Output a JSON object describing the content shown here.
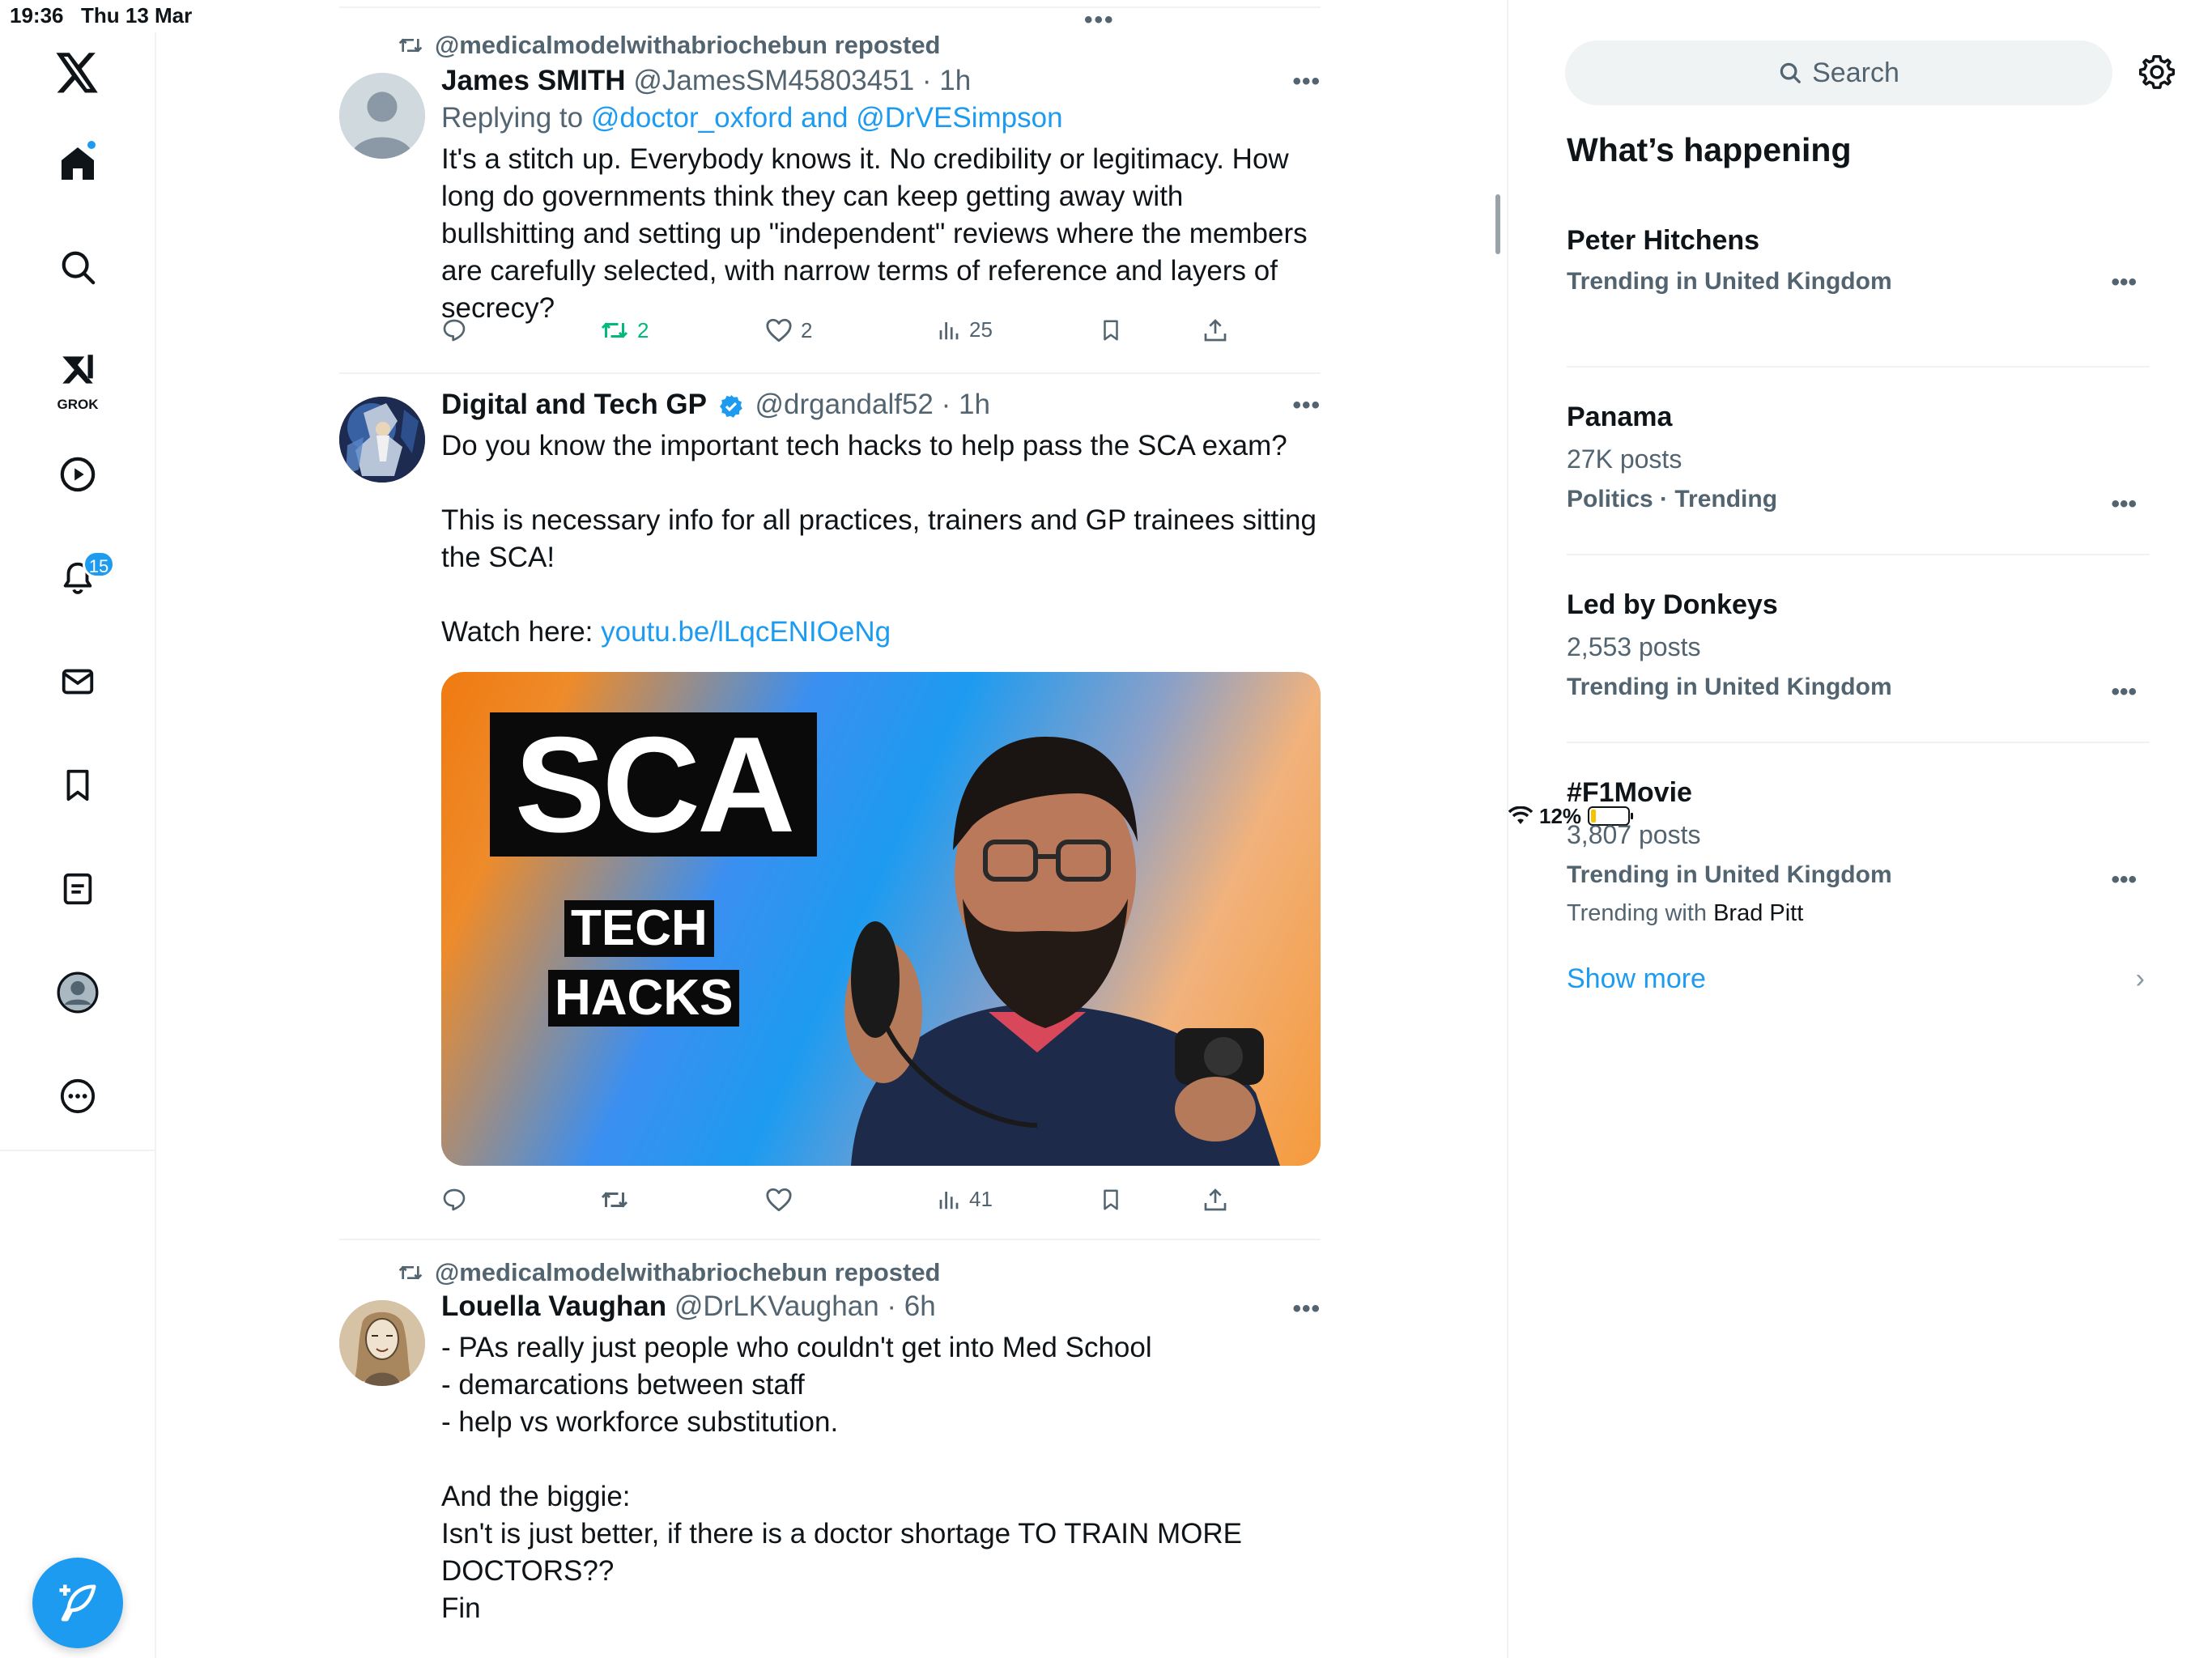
{
  "status": {
    "time": "19:36",
    "date": "Thu 13 Mar",
    "battery": "12%"
  },
  "nav": {
    "notifications_badge": "15",
    "grok_label": "GROK"
  },
  "tweets": [
    {
      "repost_by": "@medicalmodelwithabriochebun reposted",
      "name": "James SMITH",
      "handle_time": "@JamesSM45803451 · 1h",
      "reply_prefix": "Replying to ",
      "reply_to": "@doctor_oxford and @DrVESimpson",
      "text": "It's a stitch up. Everybody knows it. No credibility or legitimacy. How long do governments think they can keep getting away with bullshitting and setting up \"independent\" reviews where the members are carefully selected, with narrow terms of reference and layers of secrecy?",
      "retweets": "2",
      "likes": "2",
      "views": "25"
    },
    {
      "name": "Digital and Tech GP",
      "handle_time": "@drgandalf52 · 1h",
      "text_1": "Do you know the important tech hacks to help pass the SCA exam?",
      "text_2": "This is necessary info for all practices, trainers and GP trainees sitting the SCA!",
      "text_3_prefix": "Watch here: ",
      "link": "youtu.be/lLqcENIOeNg",
      "media": {
        "title": "SCA",
        "line1": "TECH",
        "line2": "HACKS"
      },
      "views": "41"
    },
    {
      "repost_by": "@medicalmodelwithabriochebun reposted",
      "name": "Louella Vaughan",
      "handle_time": "@DrLKVaughan · 6h",
      "text": "- PAs really just people who couldn't get into Med School\n- demarcations between staff\n- help vs workforce substitution.\n\nAnd the biggie:\nIsn't is just better, if there is a doctor shortage TO TRAIN MORE DOCTORS??\nFin"
    }
  ],
  "sidebar": {
    "search_placeholder": "Search",
    "heading": "What’s happening",
    "trends": [
      {
        "name": "Peter Hitchens",
        "meta": "Trending in United Kingdom"
      },
      {
        "name": "Panama",
        "posts": "27K posts",
        "meta": "Politics · Trending"
      },
      {
        "name": "Led by Donkeys",
        "posts": "2,553 posts",
        "meta": "Trending in United Kingdom"
      },
      {
        "name": "#F1Movie",
        "posts": "3,807 posts",
        "meta": "Trending in United Kingdom",
        "with_prefix": "Trending with ",
        "with_name": "Brad Pitt"
      }
    ],
    "show_more": "Show more"
  },
  "colors": {
    "accent": "#1d9bf0",
    "secondary_text": "#536471",
    "retweet_green": "#00ba7c"
  }
}
